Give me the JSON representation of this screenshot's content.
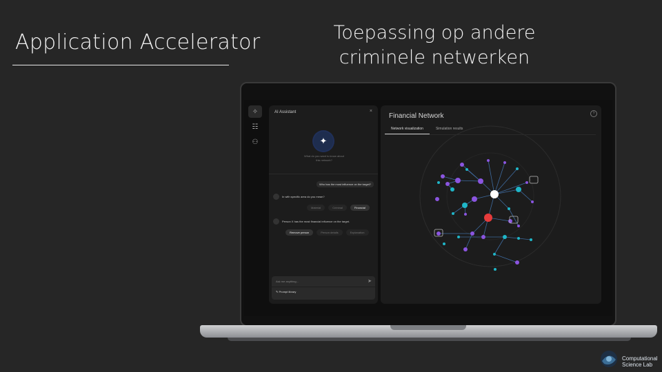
{
  "slide": {
    "title": "Application Accelerator",
    "heading_line1": "Toepassing op andere",
    "heading_line2": "criminele netwerken"
  },
  "rail": {
    "icons": [
      "sparkle-icon",
      "grid-icon",
      "users-icon"
    ]
  },
  "assistant": {
    "header": "AI Assistant",
    "close": "×",
    "prompt_line1": "What do you want to know about",
    "prompt_line2": "this network?",
    "user_question": "Who has the most influence on the target?",
    "bot_message1": "In with specific area do you mean?",
    "chips1": [
      {
        "label": "Material",
        "selected": false
      },
      {
        "label": "Criminal",
        "selected": false
      },
      {
        "label": "Financial",
        "selected": true
      }
    ],
    "bot_message2": "Person X has the most financial influence on the target.",
    "chips2": [
      {
        "label": "Remove person",
        "selected": true
      },
      {
        "label": "Person details",
        "selected": false
      },
      {
        "label": "Explanation",
        "selected": false
      }
    ],
    "input_placeholder": "Ask me anything...",
    "prompt_library": "Prompt library"
  },
  "network": {
    "title": "Financial Network",
    "tabs": [
      {
        "label": "Network visualization",
        "active": true
      },
      {
        "label": "Simulation results",
        "active": false
      }
    ]
  },
  "colors": {
    "purple": "#8b55e0",
    "cyan": "#1fb6c8",
    "red": "#e63b3b",
    "white": "#ffffff",
    "edge": "#3e6a9e"
  },
  "logo": {
    "line1": "Computational",
    "line2": "Science Lab"
  }
}
